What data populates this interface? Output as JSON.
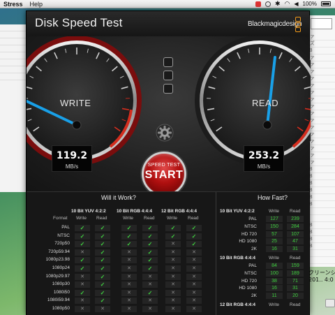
{
  "menubar": {
    "app_name": "Stress",
    "help": "Help",
    "battery": "100%"
  },
  "window": {
    "title": "Disk Speed Test",
    "brand": "Blackmagicdesign"
  },
  "gauges": {
    "write": {
      "label": "WRITE",
      "value": "119.2",
      "unit": "MB/s"
    },
    "read": {
      "label": "READ",
      "value": "253.2",
      "unit": "MB/s"
    }
  },
  "start_button": {
    "small": "SPEED TEST",
    "big": "START"
  },
  "will_it_work": {
    "title": "Will it Work?",
    "format_header": "Format",
    "groups": [
      "10 Bit YUV 4:2:2",
      "10 Bit RGB 4:4:4",
      "12 Bit RGB 4:4:4"
    ],
    "write_label": "Write",
    "read_label": "Read",
    "rows": [
      {
        "format": "PAL",
        "marks": [
          1,
          1,
          1,
          1,
          1,
          1
        ]
      },
      {
        "format": "NTSC",
        "marks": [
          1,
          1,
          1,
          1,
          1,
          1
        ]
      },
      {
        "format": "720p50",
        "marks": [
          1,
          1,
          1,
          1,
          0,
          1
        ]
      },
      {
        "format": "720p59.94",
        "marks": [
          0,
          1,
          0,
          1,
          0,
          0
        ]
      },
      {
        "format": "1080p23.98",
        "marks": [
          1,
          1,
          0,
          1,
          0,
          0
        ]
      },
      {
        "format": "1080p24",
        "marks": [
          1,
          1,
          0,
          1,
          0,
          0
        ]
      },
      {
        "format": "1080p29.97",
        "marks": [
          0,
          1,
          0,
          0,
          0,
          0
        ]
      },
      {
        "format": "1080p30",
        "marks": [
          0,
          1,
          0,
          0,
          0,
          0
        ]
      },
      {
        "format": "1080i50",
        "marks": [
          1,
          1,
          0,
          1,
          0,
          0
        ]
      },
      {
        "format": "1080i59.94",
        "marks": [
          0,
          1,
          0,
          0,
          0,
          0
        ]
      },
      {
        "format": "1080p50",
        "marks": [
          0,
          0,
          0,
          0,
          0,
          0
        ]
      }
    ]
  },
  "how_fast": {
    "title": "How Fast?",
    "write_label": "Write",
    "read_label": "Read",
    "groups": [
      {
        "name": "10 Bit YUV 4:2:2",
        "rows": [
          {
            "format": "PAL",
            "write": "127",
            "read": "239"
          },
          {
            "format": "NTSC",
            "write": "150",
            "read": "284"
          },
          {
            "format": "HD 720",
            "write": "57",
            "read": "107"
          },
          {
            "format": "HD 1080",
            "write": "25",
            "read": "47"
          },
          {
            "format": "2K",
            "write": "16",
            "read": "31"
          }
        ]
      },
      {
        "name": "10 Bit RGB 4:4:4",
        "rows": [
          {
            "format": "PAL",
            "write": "84",
            "read": "159"
          },
          {
            "format": "NTSC",
            "write": "100",
            "read": "189"
          },
          {
            "format": "HD 720",
            "write": "38",
            "read": "71"
          },
          {
            "format": "HD 1080",
            "write": "16",
            "read": "31"
          },
          {
            "format": "2K",
            "write": "11",
            "read": "20"
          }
        ]
      },
      {
        "name": "12 Bit RGB 4:4:4",
        "rows": []
      }
    ]
  },
  "background": {
    "right_rows": [
      "ファ",
      "イズ",
      "MB",
      "ファ",
      "ファ",
      "ファ",
      "ファ",
      "ファ",
      "ファ",
      "ファ",
      "ファ",
      "ファ",
      "ファ",
      "ファ",
      "ファ",
      "ファ",
      "ファ",
      "ファ",
      "ファ",
      "MB",
      "MB",
      "MB",
      "MB",
      "MB",
      "MB",
      "--",
      "--",
      "MB",
      "MB",
      "MB",
      "MB",
      "--",
      "--"
    ],
    "caption_1": "クリーンシ",
    "caption_2": "201.. 4:0"
  },
  "colors": {
    "accent_red": "#c8201e",
    "needle_blue": "#19a0e8",
    "ok_green": "#3fd23f",
    "brand_orange": "#f29a1a"
  }
}
